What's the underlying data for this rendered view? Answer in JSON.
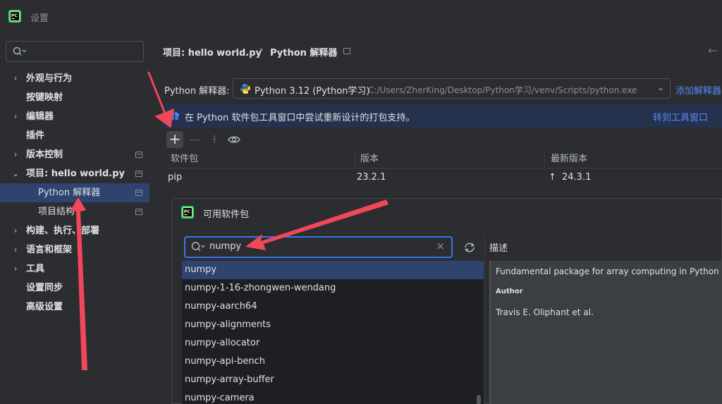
{
  "window": {
    "title": "设置"
  },
  "sidebar": {
    "search_placeholder": "",
    "items": [
      {
        "label": "外观与行为",
        "expandable": true,
        "chevron": "›"
      },
      {
        "label": "按键映射",
        "expandable": false,
        "chevron": ""
      },
      {
        "label": "编辑器",
        "expandable": true,
        "chevron": "›"
      },
      {
        "label": "插件",
        "expandable": false,
        "chevron": ""
      },
      {
        "label": "版本控制",
        "expandable": true,
        "chevron": "›"
      },
      {
        "label": "项目: hello world.py",
        "expandable": true,
        "expanded": true,
        "chevron": "⌄"
      },
      {
        "label": "Python 解释器",
        "sub": true,
        "selected": true
      },
      {
        "label": "项目结构",
        "sub": true
      },
      {
        "label": "构建、执行、部署",
        "expandable": true,
        "chevron": "›"
      },
      {
        "label": "语言和框架",
        "expandable": true,
        "chevron": "›"
      },
      {
        "label": "工具",
        "expandable": true,
        "chevron": "›"
      },
      {
        "label": "设置同步",
        "expandable": false,
        "chevron": ""
      },
      {
        "label": "高级设置",
        "expandable": false,
        "chevron": ""
      }
    ]
  },
  "header": {
    "breadcrumb_parent": "项目: hello world.py",
    "separator": "›",
    "breadcrumb_current": "Python 解释器",
    "back_glyph": "←"
  },
  "interpreter": {
    "label": "Python 解释器:",
    "value": "Python 3.12 (Python学习)",
    "path": "C:/Users/ZherKing/Desktop/Python学习/venv/Scripts/python.exe",
    "dropdown_glyph": "⌄",
    "add_link": "添加解释器"
  },
  "banner": {
    "text": "在 Python 软件包工具窗口中尝试重新设计的打包支持。",
    "link": "转到工具窗口"
  },
  "toolbar": {
    "add": "+",
    "remove": "—",
    "upgrade": "⭱",
    "show": "◉"
  },
  "packages_table": {
    "columns": [
      "软件包",
      "版本",
      "最新版本"
    ],
    "rows": [
      {
        "name": "pip",
        "version": "23.2.1",
        "latest": "24.3.1",
        "upgrade_icon": "↑"
      }
    ]
  },
  "available_packages": {
    "title": "可用软件包",
    "search_value": "numpy",
    "clear_glyph": "×",
    "description_label": "描述",
    "items": [
      "numpy",
      "numpy-1-16-zhongwen-wendang",
      "numpy-aarch64",
      "numpy-alignments",
      "numpy-allocator",
      "numpy-api-bench",
      "numpy-array-buffer",
      "numpy-camera"
    ],
    "selected_index": 0,
    "description": {
      "summary": "Fundamental package for array computing in Python",
      "author_label": "Author",
      "author": "Travis E. Oliphant et al."
    }
  },
  "colors": {
    "background": "#2b2d30",
    "selection": "#2e436e",
    "accent": "#3574f0",
    "link": "#548af7",
    "annotation": "#f0475a"
  }
}
